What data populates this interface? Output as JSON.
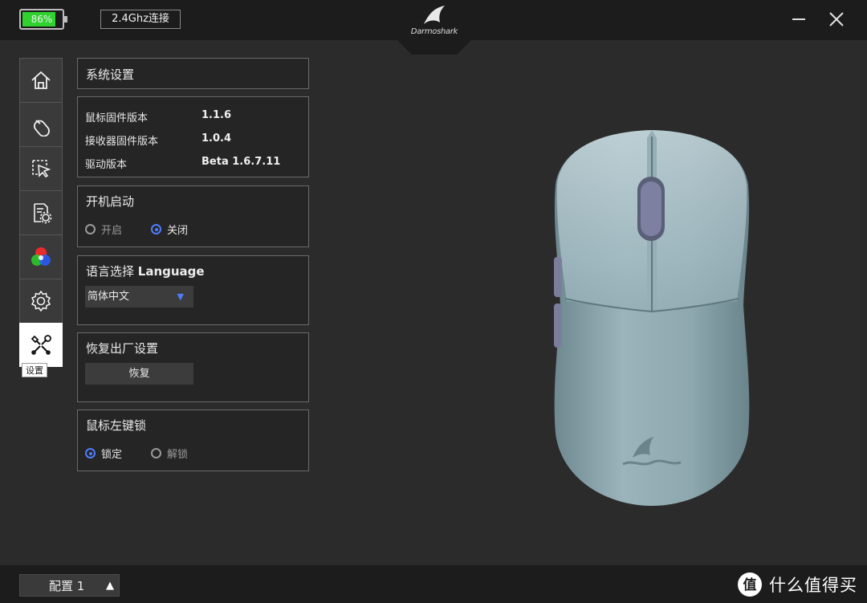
{
  "titlebar": {
    "battery_text": "86%",
    "battery_level": 0.86,
    "connection": "2.4Ghz连接",
    "logo": "Darmoshark"
  },
  "sidebar": {
    "items": [
      {
        "name": "home",
        "icon": "home-icon"
      },
      {
        "name": "mouse",
        "icon": "mouse-icon"
      },
      {
        "name": "cursor",
        "icon": "cursor-click-icon"
      },
      {
        "name": "macro",
        "icon": "macro-settings-icon"
      },
      {
        "name": "lighting",
        "icon": "rgb-circles-icon"
      },
      {
        "name": "settings",
        "icon": "gear-icon"
      },
      {
        "name": "system",
        "icon": "tools-icon",
        "active": true
      }
    ],
    "tooltip": "设置"
  },
  "system": {
    "title": "系统设置"
  },
  "versions": {
    "rows": [
      {
        "label": "鼠标固件版本",
        "value": "1.1.6"
      },
      {
        "label": "接收器固件版本",
        "value": "1.0.4"
      },
      {
        "label": "驱动版本",
        "value": "Beta 1.6.7.11"
      }
    ]
  },
  "startup": {
    "title": "开机启动",
    "on_label": "开启",
    "off_label": "关闭",
    "selected": "off"
  },
  "language": {
    "title_cn": "语言选择 ",
    "title_en": "Language",
    "selected": "简体中文"
  },
  "reset": {
    "title": "恢复出厂设置",
    "button": "恢复"
  },
  "leftlock": {
    "title": "鼠标左键锁",
    "lock_label": "锁定",
    "unlock_label": "解锁",
    "selected": "lock"
  },
  "bottom": {
    "profile": "配置 1",
    "watermark": "什么值得买"
  },
  "colors": {
    "accent": "#4f7cff",
    "battery": "#2fd22f",
    "mouse_body": "#8fa9b1"
  }
}
